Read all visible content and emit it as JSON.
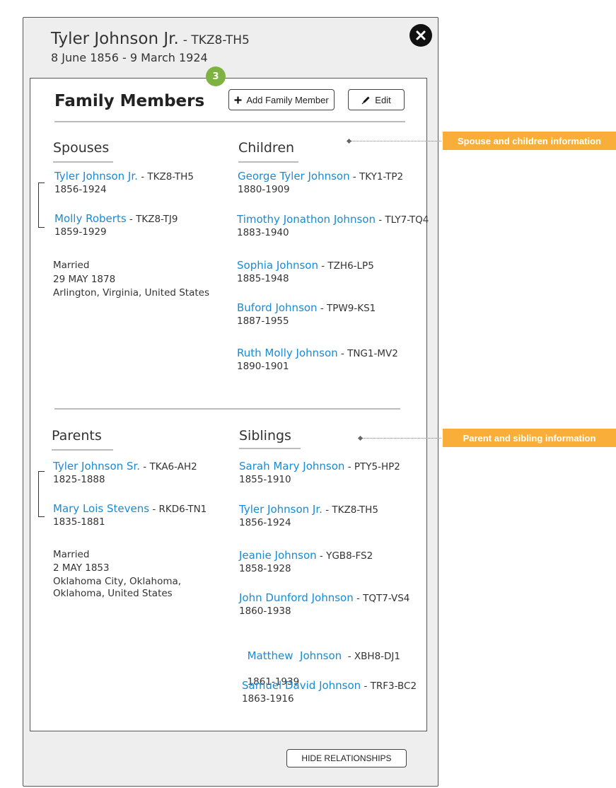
{
  "person": {
    "name": "Tyler Johnson Jr.",
    "id": "- TKZ8-TH5",
    "dates": "8 June 1856 - 9 March 1924"
  },
  "close_icon": "close-icon",
  "badge": "3",
  "section": {
    "title": "Family Members",
    "add_button": "Add Family Member",
    "edit_button": "Edit"
  },
  "spouses": {
    "heading": "Spouses",
    "items": [
      {
        "name": "Tyler Johnson Jr.",
        "id": " - TKZ8-TH5",
        "years": "1856-1924"
      },
      {
        "name": "Molly Roberts",
        "id": " - TKZ8-TJ9",
        "years": "1859-1929"
      }
    ],
    "marriage": {
      "label": "Married",
      "date": "29 MAY 1878",
      "place": "Arlington, Virginia, United States"
    }
  },
  "children": {
    "heading": "Children",
    "items": [
      {
        "name": "George Tyler Johnson",
        "id": " - TKY1-TP2",
        "years": "1880-1909"
      },
      {
        "name": "Timothy Jonathon Johnson",
        "id": " - TLY7-TQ4",
        "years": "1883-1940"
      },
      {
        "name": "Sophia Johnson",
        "id": " - TZH6-LP5",
        "years": "1885-1948"
      },
      {
        "name": "Buford Johnson",
        "id": " - TPW9-KS1",
        "years": "1887-1955"
      },
      {
        "name": "Ruth Molly Johnson",
        "id": " - TNG1-MV2",
        "years": "1890-1901"
      }
    ]
  },
  "parents": {
    "heading": "Parents",
    "items": [
      {
        "name": "Tyler Johnson Sr.",
        "id": " - TKA6-AH2",
        "years": "1825-1888"
      },
      {
        "name": "Mary Lois Stevens",
        "id": " - RKD6-TN1",
        "years": "1835-1881"
      }
    ],
    "marriage": {
      "label": "Married",
      "date": "2 MAY 1853",
      "place_line1": "Oklahoma City, Oklahoma,",
      "place_line2": "Oklahoma, United States"
    }
  },
  "siblings": {
    "heading": "Siblings",
    "items": [
      {
        "name": "Sarah Mary Johnson",
        "id": " - PTY5-HP2",
        "years": "1855-1910"
      },
      {
        "name": "Tyler Johnson Jr.",
        "id": " - TKZ8-TH5",
        "years": "1856-1924"
      },
      {
        "name": "Jeanie Johnson",
        "id": " - YGB8-FS2",
        "years": "1858-1928"
      },
      {
        "name": "John Dunford Johnson",
        "id": " - TQT7-VS4",
        "years": "1860-1938"
      },
      {
        "name": "Matthew  Johnson",
        "id": "  - XBH8-DJ1",
        "years": "1861-1939"
      },
      {
        "name": "Samuel David Johnson",
        "id": " - TRF3-BC2",
        "years": "1863-1916"
      }
    ]
  },
  "footer": {
    "hide_button": "HIDE RELATIONSHIPS"
  },
  "annotations": {
    "spouse_children": "Spouse and children information",
    "parent_sibling": "Parent and sibling information"
  },
  "colors": {
    "link": "#1a8ad4",
    "badge": "#7fb341",
    "callout": "#f8ae38"
  }
}
